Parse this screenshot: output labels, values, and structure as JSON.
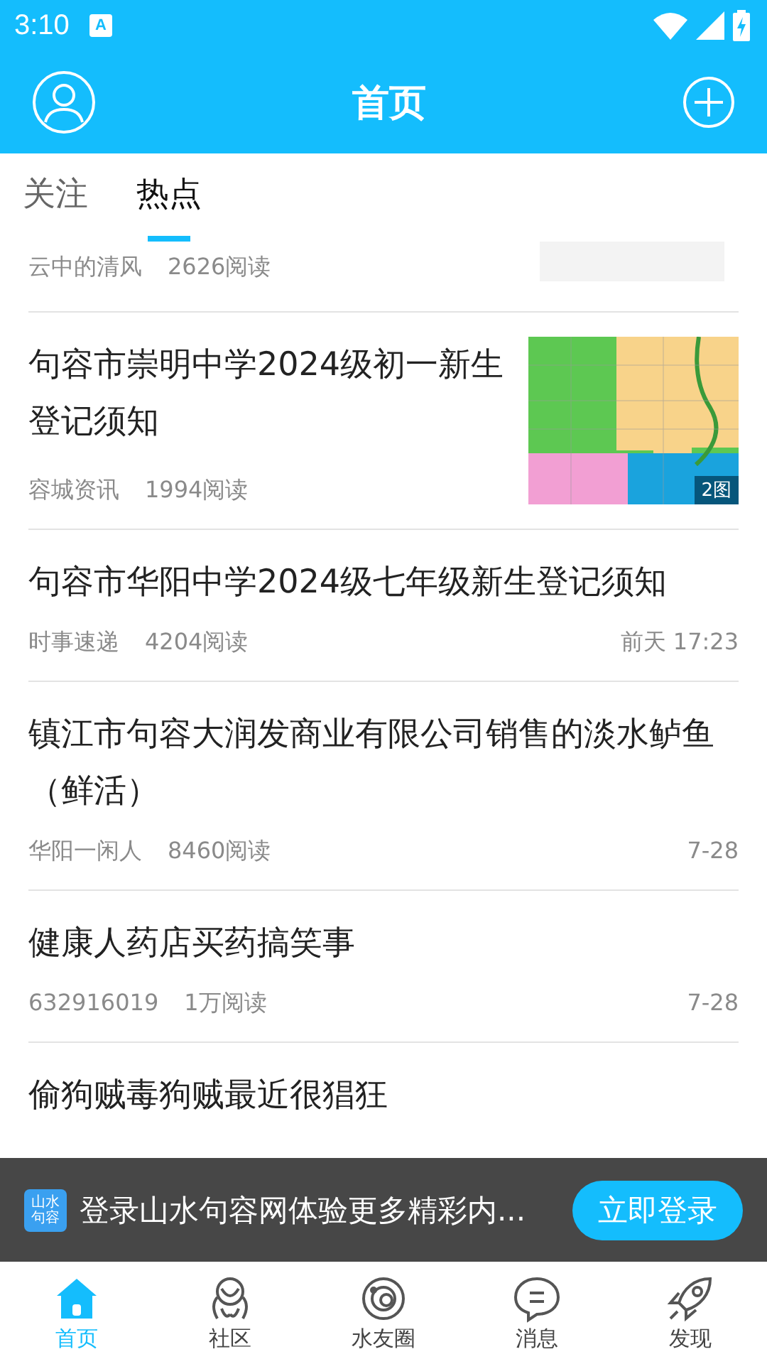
{
  "status_bar": {
    "time": "3:10",
    "notification_letter": "A"
  },
  "header": {
    "title": "首页"
  },
  "tabs": [
    {
      "label": "关注",
      "selected": false
    },
    {
      "label": "热点",
      "selected": true
    }
  ],
  "articles": [
    {
      "kind": "partial",
      "author": "云中的清风",
      "reads": "2626阅读"
    },
    {
      "kind": "thumbnail",
      "title": "句容市崇明中学2024级初一新生登记须知",
      "author": "容城资讯",
      "reads": "1994阅读",
      "image_count": "2图"
    },
    {
      "kind": "text",
      "title": "句容市华阳中学2024级七年级新生登记须知",
      "author": "时事速递",
      "reads": "4204阅读",
      "time": "前天 17:23"
    },
    {
      "kind": "text",
      "title": "镇江市句容大润发商业有限公司销售的淡水鲈鱼（鲜活）",
      "author": "华阳一闲人",
      "reads": "8460阅读",
      "time": "7-28"
    },
    {
      "kind": "text",
      "title": "健康人药店买药搞笑事",
      "author": "632916019",
      "reads": "1万阅读",
      "time": "7-28"
    },
    {
      "kind": "text",
      "title": "偷狗贼毒狗贼最近很猖狂"
    }
  ],
  "login_banner": {
    "logo_text": "山水句容",
    "message": "登录山水句容网体验更多精彩内...",
    "button": "立即登录"
  },
  "bottom_nav": [
    {
      "label": "首页",
      "selected": true
    },
    {
      "label": "社区",
      "selected": false
    },
    {
      "label": "水友圈",
      "selected": false
    },
    {
      "label": "消息",
      "selected": false
    },
    {
      "label": "发现",
      "selected": false
    }
  ]
}
